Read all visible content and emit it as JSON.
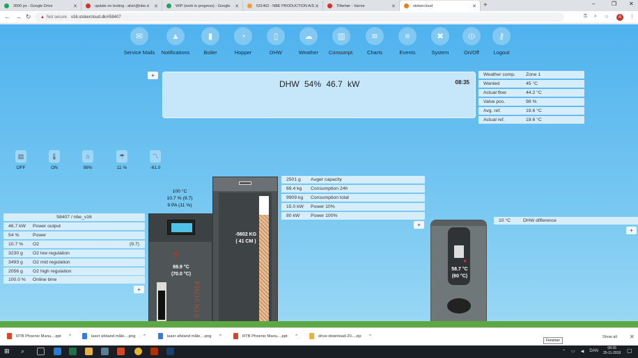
{
  "browser": {
    "tabs": [
      {
        "title": "3000 px - Google Drive",
        "color": "#1fa463"
      },
      {
        "title": "update on testing - alvin@nbe.d",
        "color": "#d93025"
      },
      {
        "title": "WIP (work in progress) - Google",
        "color": "#1fa463"
      },
      {
        "title": "531462 - NBE PRODUCTION A/S",
        "color": "#f0a030"
      },
      {
        "title": "Tilbehør - Varme",
        "color": "#d93025"
      },
      {
        "title": "stokercloud",
        "color": "#f07b1a"
      }
    ],
    "new_tab": "+",
    "window_controls": {
      "minimize": "–",
      "maximize": "❐",
      "close": "✕"
    },
    "back": "←",
    "forward": "→",
    "reload": "↻",
    "not_secure_label": "Not secure",
    "url": "v16.stokercloud.dk/#58407",
    "avatar_letter": "A"
  },
  "nav": [
    {
      "label": "Service Mails",
      "icon": "mail-icon",
      "glyph": "✉"
    },
    {
      "label": "Notifications",
      "icon": "bell-icon",
      "glyph": "🔔"
    },
    {
      "label": "Boiler",
      "icon": "boiler-icon",
      "glyph": "▮"
    },
    {
      "label": "Hopper",
      "icon": "gauge-icon",
      "glyph": "◔"
    },
    {
      "label": "DHW",
      "icon": "tank-icon",
      "glyph": "▯"
    },
    {
      "label": "Weather",
      "icon": "cloud-icon",
      "glyph": "☁"
    },
    {
      "label": "Consumpt.",
      "icon": "bar-chart-icon",
      "glyph": "▥"
    },
    {
      "label": "Charts",
      "icon": "chart-icon",
      "glyph": "≋"
    },
    {
      "label": "Events",
      "icon": "list-icon",
      "glyph": "≡"
    },
    {
      "label": "System",
      "icon": "tools-icon",
      "glyph": "✖"
    },
    {
      "label": "On/Off",
      "icon": "power-icon",
      "glyph": "⏻"
    },
    {
      "label": "Logout",
      "icon": "key-icon",
      "glyph": "⚷"
    }
  ],
  "main": {
    "status": "DHW  54%  46.7 kW",
    "clock": "08:35"
  },
  "weather": [
    {
      "key": "Weather comp.",
      "value": "Zone 1"
    },
    {
      "key": "Wanted",
      "value": "45 °C"
    },
    {
      "key": "Actual flow",
      "value": "44.2 °C"
    },
    {
      "key": "Valve pos.",
      "value": "98 %"
    },
    {
      "key": "Avg. ref.",
      "value": "19.6 °C"
    },
    {
      "key": "Actual ref.",
      "value": "19.6 °C"
    }
  ],
  "status_icons": [
    {
      "icon": "heater-icon",
      "value": "OFF"
    },
    {
      "icon": "thermometer-icon",
      "value": "ON"
    },
    {
      "icon": "house-icon",
      "value": "98%"
    },
    {
      "icon": "weather-icon",
      "value": "11 %"
    },
    {
      "icon": "wind-icon",
      "value": "-61.0"
    }
  ],
  "boiler": {
    "info": [
      "100 °C",
      "10.7 % (9.7)",
      "9 PA (11 %)"
    ],
    "temp": [
      "69.9 °C",
      "(70.0 °C)"
    ],
    "brand": "PHOENIX"
  },
  "hopper": {
    "content": [
      "-5602 KG",
      "( 41 CM )"
    ],
    "fill_level": 0.85
  },
  "dhw_tank": {
    "temp": [
      "58.7 °C",
      "(60 °C)"
    ]
  },
  "plant": {
    "title": "58407 / nbe_v16",
    "rows": [
      {
        "a": "46.7 kW",
        "b": "Power output",
        "c": ""
      },
      {
        "a": "54 %",
        "b": "Power",
        "c": ""
      },
      {
        "a": "10.7 %",
        "b": "O2",
        "c": "(9.7)"
      },
      {
        "a": "3230 g",
        "b": "O2 low regulation",
        "c": ""
      },
      {
        "a": "3493 g",
        "b": "O2 mid regulation",
        "c": ""
      },
      {
        "a": "2056 g",
        "b": "O2 high regulation",
        "c": ""
      },
      {
        "a": "100.0 %",
        "b": "Online time",
        "c": ""
      }
    ]
  },
  "hopper_stats": [
    {
      "a": "2501 g",
      "b": "Auger capacity"
    },
    {
      "a": "69.4 kg",
      "b": "Consumption 24h"
    },
    {
      "a": "9909 kg",
      "b": "Consumption total"
    },
    {
      "a": "15.0 kW",
      "b": "Power 10%"
    },
    {
      "a": "80 kW",
      "b": "Power 100%"
    }
  ],
  "dhw_diff": {
    "a": "10 °C",
    "b": "DHW difference"
  },
  "plus_label": "+",
  "downloads": [
    {
      "name": "RTB Phoenix Manu....ppt",
      "color": "#d24726"
    },
    {
      "name": "laser afstand måle....png",
      "color": "#3a7bd5"
    },
    {
      "name": "laser afstand måle....png",
      "color": "#3a7bd5"
    },
    {
      "name": "RTB Phoenix Manu....ppt",
      "color": "#d24726"
    },
    {
      "name": "drive-download-20....zip",
      "color": "#e8b04a"
    }
  ],
  "show_all": "Show all",
  "tooltip": "Fenomer",
  "taskbar": {
    "lang": "DAN",
    "time": "08:35",
    "date": "25-11-2019"
  }
}
